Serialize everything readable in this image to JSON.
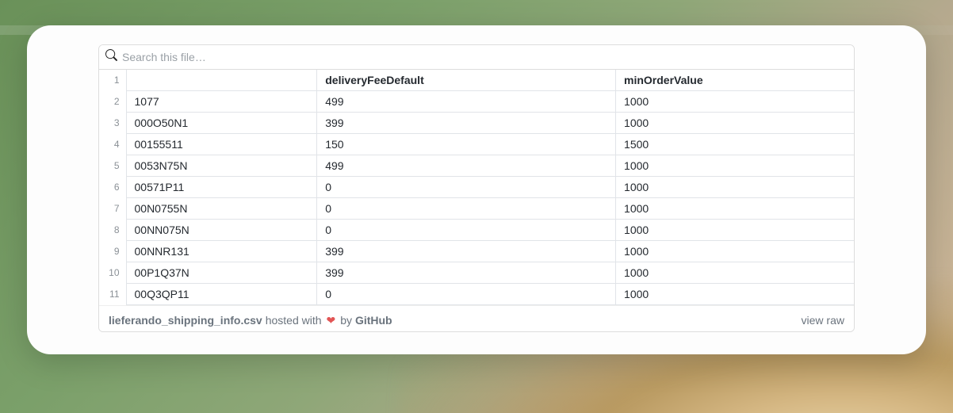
{
  "search": {
    "placeholder": "Search this file…"
  },
  "columns": [
    "",
    "deliveryFeeDefault",
    "minOrderValue"
  ],
  "rows": [
    {
      "n": 1,
      "cells": [
        "",
        "deliveryFeeDefault",
        "minOrderValue"
      ],
      "header": true
    },
    {
      "n": 2,
      "cells": [
        "1077",
        "499",
        "1000"
      ]
    },
    {
      "n": 3,
      "cells": [
        "000O50N1",
        "399",
        "1000"
      ]
    },
    {
      "n": 4,
      "cells": [
        "00155511",
        "150",
        "1500"
      ]
    },
    {
      "n": 5,
      "cells": [
        "0053N75N",
        "499",
        "1000"
      ]
    },
    {
      "n": 6,
      "cells": [
        "00571P11",
        "0",
        "1000"
      ]
    },
    {
      "n": 7,
      "cells": [
        "00N0755N",
        "0",
        "1000"
      ]
    },
    {
      "n": 8,
      "cells": [
        "00NN075N",
        "0",
        "1000"
      ]
    },
    {
      "n": 9,
      "cells": [
        "00NNR131",
        "399",
        "1000"
      ]
    },
    {
      "n": 10,
      "cells": [
        "00P1Q37N",
        "399",
        "1000"
      ]
    },
    {
      "n": 11,
      "cells": [
        "00Q3QP11",
        "0",
        "1000"
      ]
    }
  ],
  "meta": {
    "filename": "lieferando_shipping_info.csv",
    "hosted_with": "hosted with",
    "by": "by",
    "provider": "GitHub",
    "view_raw": "view raw"
  }
}
